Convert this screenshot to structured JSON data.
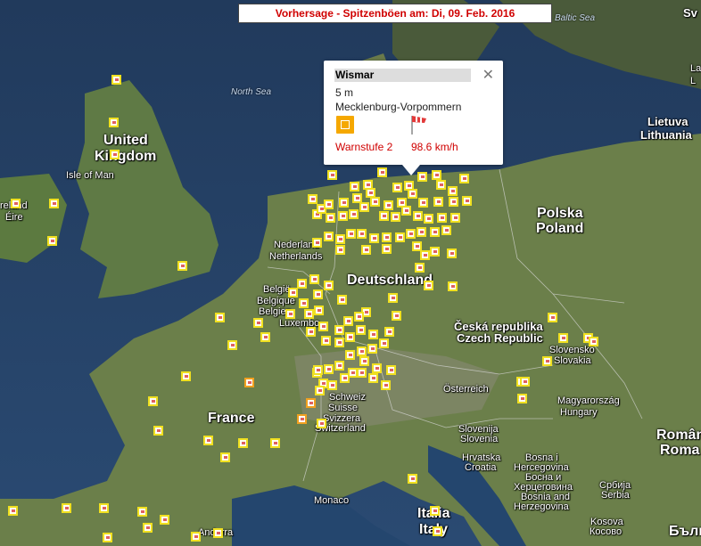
{
  "title": "Vorhersage - Spitzenböen am: Di, 09. Feb. 2016",
  "popup": {
    "station": "Wismar",
    "altitude": "5 m",
    "region": "Mecklenburg-Vorpommern",
    "warnlevel": "Warnstufe 2",
    "speed": "98.6  km/h",
    "close_icon": "close-icon",
    "warn_icon": "warning-level-icon",
    "wind_icon": "windsock-icon",
    "colors": {
      "warn_badge": "#f5a800",
      "warn_text": "#d00000"
    }
  },
  "labels": {
    "uk": [
      "United",
      "Kingdom"
    ],
    "isle_of_man": "Isle of Man",
    "north_sea": "North Sea",
    "baltic_sea": "Baltic Sea",
    "ireland_top": "reland",
    "ireland_bot": "Éire",
    "lithuania": [
      "Lietuva",
      "Lithuania"
    ],
    "poland": [
      "Polska",
      "Poland"
    ],
    "netherlands": [
      "Nederland",
      "Netherlands"
    ],
    "germany": "Deutschland",
    "belgium": [
      "België",
      "Belgique",
      "Belgien"
    ],
    "luxembourg": "Luxembo",
    "czech": [
      "Česká republika",
      "Czech Republic"
    ],
    "slovakia": [
      "Slovensko",
      "Slovakia"
    ],
    "austria": "Österreich",
    "hungary": [
      "Magyarország",
      "Hungary"
    ],
    "france": "France",
    "switzerland": [
      "Schweiz",
      "Suisse",
      "Svizzera",
      "Switzerland"
    ],
    "slovenia": [
      "Slovenija",
      "Slovenia"
    ],
    "croatia": [
      "Hrvatska",
      "Croatia"
    ],
    "bosnia": [
      "Bosna i",
      "Hercegovina",
      "Босна и",
      "Херцеговина",
      "Bosnia and",
      "Herzegovina"
    ],
    "serbia": [
      "Србија",
      "Serbia"
    ],
    "romania": [
      "Români",
      "Roma"
    ],
    "monaco": "Monaco",
    "italy": [
      "Italia",
      "Italy"
    ],
    "andorra": "Andorra",
    "kosovo": [
      "Kosova",
      "Косово"
    ],
    "bulgaria": "Бълга",
    "sweden_top": "Sv",
    "estonia_frag": [
      "La",
      "L"
    ]
  },
  "colors": {
    "marker_border": "#f0e020",
    "marker_border_warn": "#f0a020",
    "title_text": "#d00000"
  }
}
